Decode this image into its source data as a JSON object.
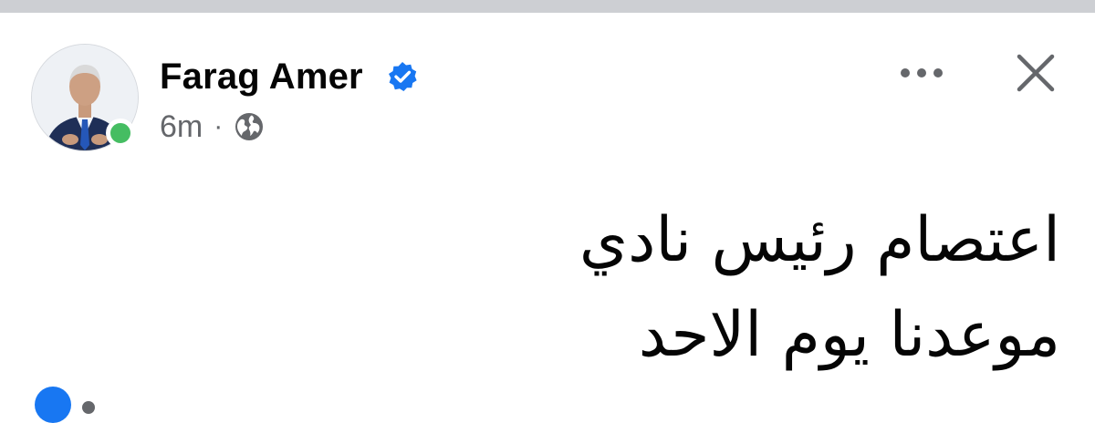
{
  "post": {
    "author_name": "Farag Amer",
    "verified": true,
    "timestamp": "6m",
    "separator": "·",
    "audience_icon": "globe-icon",
    "online_status": "online",
    "text": "اعتصام رئيس نادي\nموعدنا  يوم الاحد"
  },
  "icons": {
    "more": "more-horizontal-icon",
    "close": "close-icon",
    "verified": "verified-badge-icon"
  },
  "colors": {
    "verified_blue": "#1877f2",
    "online_green": "#45bd62",
    "secondary_text": "#65676b",
    "primary_text": "#050505"
  }
}
